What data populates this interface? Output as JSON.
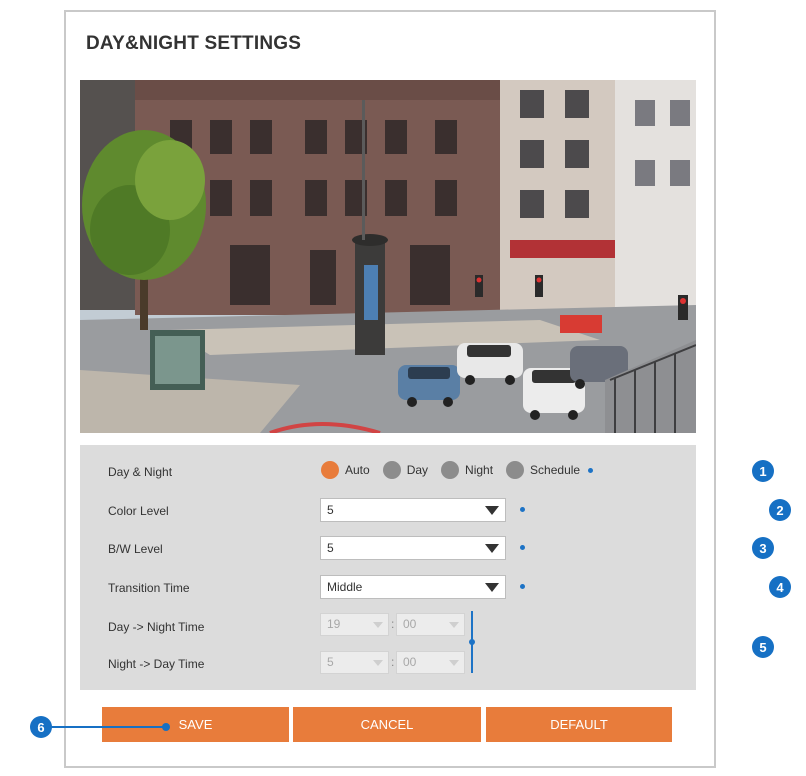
{
  "page": {
    "title": "DAY&NIGHT SETTINGS"
  },
  "settings": {
    "day_night": {
      "label": "Day & Night",
      "options": [
        "Auto",
        "Day",
        "Night",
        "Schedule"
      ],
      "selected": "Auto"
    },
    "color_level": {
      "label": "Color Level",
      "value": "5"
    },
    "bw_level": {
      "label": "B/W Level",
      "value": "5"
    },
    "transition_time": {
      "label": "Transition Time",
      "value": "Middle"
    },
    "day_to_night": {
      "label": "Day -> Night Time",
      "hour": "19",
      "minute": "00"
    },
    "night_to_day": {
      "label": "Night -> Day Time",
      "hour": "5",
      "minute": "00"
    }
  },
  "buttons": {
    "save": "SAVE",
    "cancel": "CANCEL",
    "default": "DEFAULT"
  },
  "callouts": [
    "1",
    "2",
    "3",
    "4",
    "5",
    "6"
  ],
  "colors": {
    "accent": "#e87c3b",
    "marker_blue": "#1670c4",
    "panel_gray": "#dcdcdc"
  }
}
